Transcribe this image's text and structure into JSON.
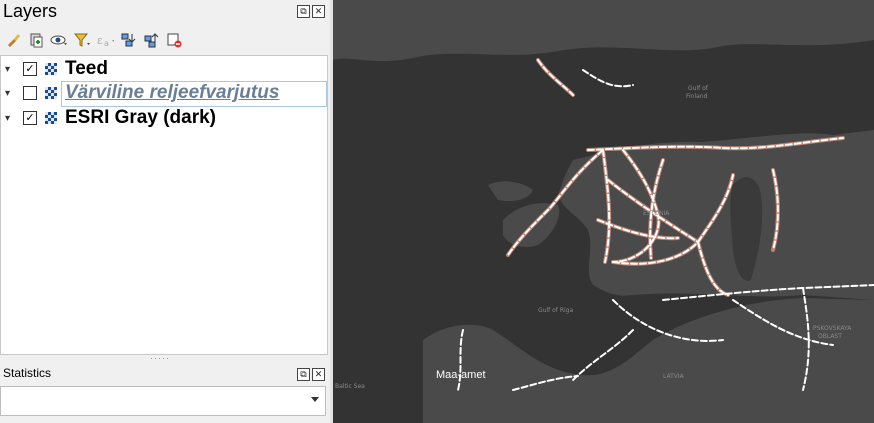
{
  "layers_panel": {
    "title": "Layers",
    "dock_float": "⧉",
    "dock_close": "✕",
    "layers": [
      {
        "name": "Teed",
        "checked": true,
        "check_mark": "✓",
        "expander": "▾"
      },
      {
        "name": "Värviline reljeefvarjutus",
        "checked": false,
        "check_mark": "",
        "expander": "▾"
      },
      {
        "name": "ESRI Gray (dark)",
        "checked": true,
        "check_mark": "✓",
        "expander": "▾"
      }
    ]
  },
  "statistics_panel": {
    "title": "Statistics",
    "dock_float": "⧉",
    "dock_close": "✕"
  },
  "map": {
    "attribution": "Maa-amet",
    "background_color": "#333333",
    "land_color": "#4a4a4a",
    "road_color": "#ffffff",
    "road_outline_color": "#c98a78"
  }
}
